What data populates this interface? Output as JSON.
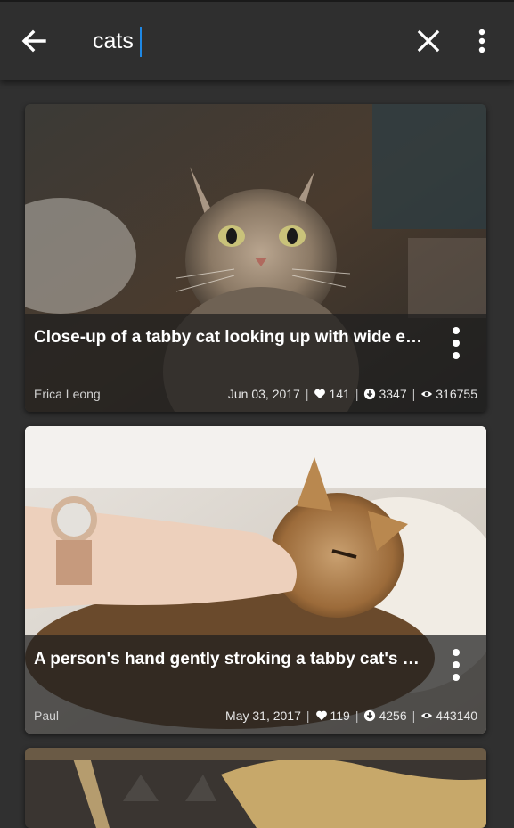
{
  "search": {
    "query": "cats"
  },
  "icons": {
    "back": "arrow-left-icon",
    "clear": "close-icon",
    "menu": "more-vert-icon",
    "likes": "heart-icon",
    "downloads": "download-icon",
    "views": "eye-icon"
  },
  "colors": {
    "caret": "#1e88e5",
    "appbar": "#2f2f2f",
    "background": "#303030"
  },
  "cards": [
    {
      "title": "Close-up of a tabby cat looking up with wide eyes",
      "author": "Erica Leong",
      "date": "Jun 03, 2017",
      "likes": "141",
      "downloads": "3347",
      "views": "316755"
    },
    {
      "title": "A person's hand gently stroking a tabby cat's chin",
      "author": "Paul",
      "date": "May 31, 2017",
      "likes": "119",
      "downloads": "4256",
      "views": "443140"
    }
  ]
}
